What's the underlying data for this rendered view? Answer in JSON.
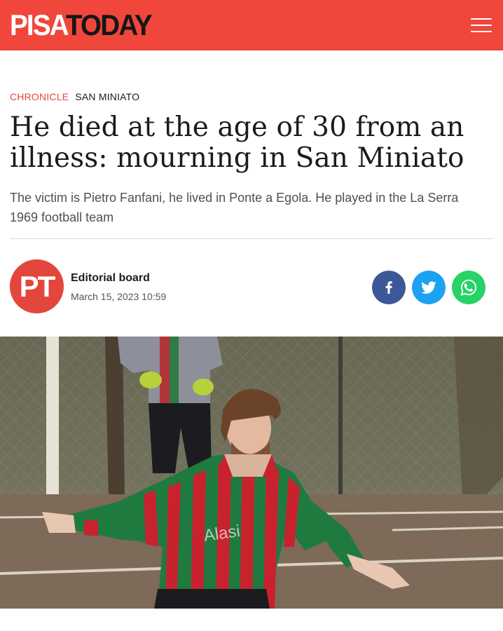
{
  "header": {
    "logo_part1": "PISA",
    "logo_part2": "TODAY",
    "menu_icon": "hamburger-menu-icon",
    "brand_color": "#f0463b"
  },
  "article": {
    "category": "CHRONICLE",
    "location": "SAN MINIATO",
    "title": "He died at the age of 30 from an illness: mourning in San Miniato",
    "standfirst": "The victim is Pietro Fanfani, he lived in Ponte a Egola. He played in the La Serra 1969 football team"
  },
  "author": {
    "initials": "PT",
    "name": "Editorial board",
    "date": "March 15, 2023 10:59"
  },
  "share": [
    {
      "icon": "facebook-icon",
      "color": "#3b5998"
    },
    {
      "icon": "twitter-icon",
      "color": "#1da1f2"
    },
    {
      "icon": "whatsapp-icon",
      "color": "#25d366"
    }
  ],
  "hero_image": {
    "subject": "football player in red and green striped jersey kicking a ball, goalkeeper behind",
    "jersey_text": "Alasi"
  }
}
